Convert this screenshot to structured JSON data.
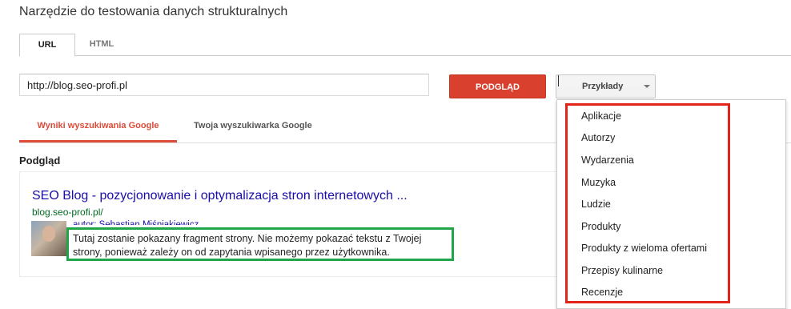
{
  "page": {
    "title": "Narzędzie do testowania danych strukturalnych"
  },
  "tabs": {
    "url": "URL",
    "html": "HTML"
  },
  "input": {
    "url_value": "http://blog.seo-profi.pl"
  },
  "buttons": {
    "preview": "PODGLĄD",
    "examples": "Przykłady"
  },
  "subtabs": {
    "google": "Wyniki wyszukiwania Google",
    "custom": "Twoja wyszukiwarka Google"
  },
  "preview": {
    "label": "Podgląd",
    "result_title": "SEO Blog - pozycjonowanie i optymalizacja stron internetowych ...",
    "result_url": "blog.seo-profi.pl/",
    "author": "autor: Sebastian Miśniakiewicz",
    "snippet": "Tutaj zostanie pokazany fragment strony. Nie możemy pokazać tekstu z Twojej strony, ponieważ zależy on od zapytania wpisanego przez użytkownika."
  },
  "dropdown": {
    "items": [
      "Aplikacje",
      "Autorzy",
      "Wydarzenia",
      "Muzyka",
      "Ludzie",
      "Produkty",
      "Produkty z wieloma ofertami",
      "Przepisy kulinarne",
      "Recenzje"
    ]
  },
  "colors": {
    "accent_red": "#d9412e",
    "link_blue": "#1a0dab",
    "url_green": "#006621",
    "highlight_green": "#1fa649",
    "highlight_red": "#e2231a"
  }
}
